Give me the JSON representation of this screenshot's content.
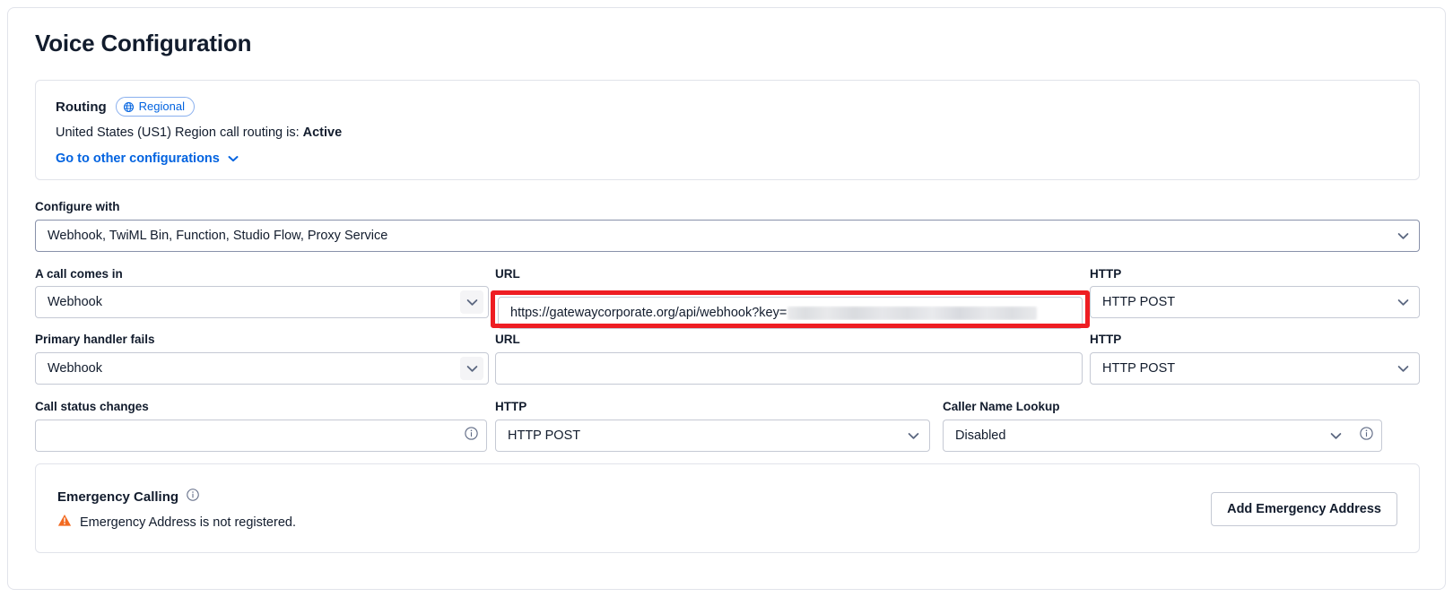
{
  "page": {
    "title": "Voice Configuration"
  },
  "routing": {
    "label": "Routing",
    "badge": "Regional",
    "badge_icon": "globe-icon",
    "status_prefix": "United States (US1) Region call routing is:",
    "status_value": "Active",
    "link": "Go to other configurations",
    "link_chevron_icon": "chevron-down-icon"
  },
  "configure_with": {
    "label": "Configure with",
    "value": "Webhook, TwiML Bin, Function, Studio Flow, Proxy Service"
  },
  "call_comes_in": {
    "label": "A call comes in",
    "handler_value": "Webhook",
    "url_label": "URL",
    "url_value_visible": "https://gatewaycorporate.org/api/webhook?key=",
    "url_value_redacted": "redacted-api-key",
    "http_label": "HTTP",
    "http_value": "HTTP POST"
  },
  "primary_handler_fails": {
    "label": "Primary handler fails",
    "handler_value": "Webhook",
    "url_label": "URL",
    "url_value": "",
    "url_placeholder": "",
    "http_label": "HTTP",
    "http_value": "HTTP POST"
  },
  "call_status_changes": {
    "label": "Call status changes",
    "url_value": "",
    "url_placeholder": "",
    "info_icon": "info-icon",
    "http_label": "HTTP",
    "http_value": "HTTP POST"
  },
  "caller_name_lookup": {
    "label": "Caller Name Lookup",
    "value": "Disabled",
    "info_icon": "info-icon"
  },
  "emergency": {
    "title": "Emergency Calling",
    "title_info_icon": "info-icon",
    "warning_icon": "warning-triangle-icon",
    "warning_text": "Emergency Address is not registered.",
    "button_label": "Add Emergency Address"
  },
  "annotation": {
    "highlight_color": "#ee1d23",
    "target": "call-comes-in-url-input"
  },
  "colors": {
    "link": "#0263e0",
    "text": "#121c2d",
    "border": "#c5c9d4",
    "panel_border": "#e1e3ea",
    "warning": "#f26a21"
  }
}
